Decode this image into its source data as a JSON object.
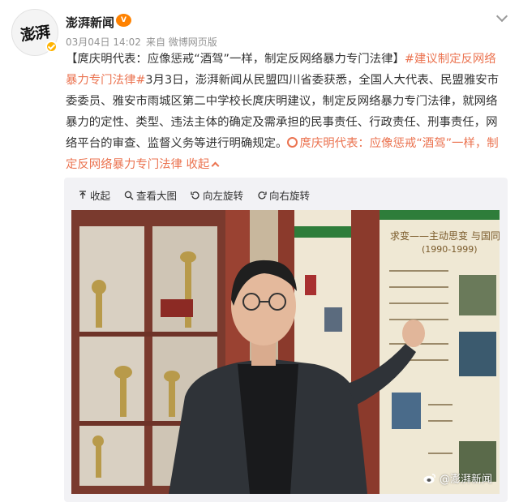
{
  "author": {
    "name": "澎湃新闻",
    "avatar_logo": "澎湃",
    "vip_badge": "V"
  },
  "meta": {
    "date": "03月04日 14:02",
    "source": "来自 微博网页版"
  },
  "post": {
    "title_bracketed": "【庹庆明代表：应像惩戒“酒驾”一样，制定反网络暴力专门法律】",
    "topic": "#建议制定反网络暴力专门法律#",
    "body": "3月3日，澎湃新闻从民盟四川省委获悉，全国人大代表、民盟雅安市委委员、雅安市雨城区第二中学校长庹庆明建议，制定反网络暴力专门法律，就网络暴力的定性、类型、违法主体的确定及需承担的民事责任、行政责任、刑事责任，网络平台的审查、监督义务等进行明确规定。",
    "link_text": "庹庆明代表：应像惩戒“酒驾”一样，制定反网络暴力专门法律",
    "collapse_label": "收起"
  },
  "media_toolbar": {
    "collapse": "收起",
    "view_large": "查看大图",
    "rotate_left": "向左旋转",
    "rotate_right": "向右旋转"
  },
  "photo": {
    "board_heading": "求变——主动思变 与国同兴",
    "board_years": "(1990-1999)",
    "watermark": "@澎湃新闻"
  },
  "colors": {
    "topic": "#eb7350",
    "vip": "#ff8200",
    "card_bg": "#f2f2f5"
  }
}
